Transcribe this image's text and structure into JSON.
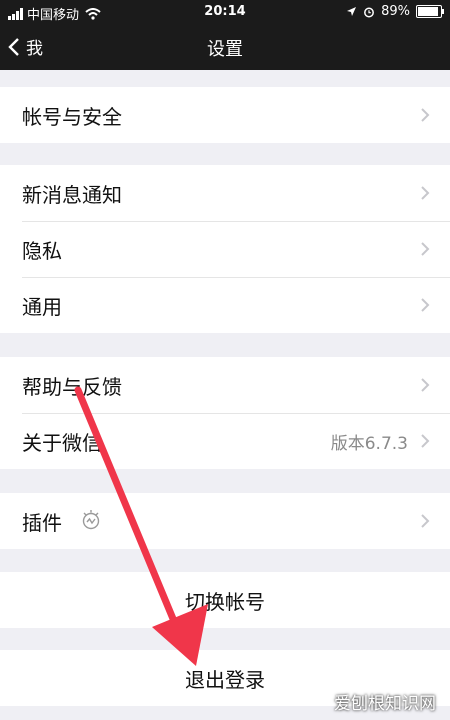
{
  "status": {
    "carrier": "中国移动",
    "time": "20:14",
    "battery": "89%",
    "battery_level": 0.89
  },
  "nav": {
    "back_label": "我",
    "title": "设置"
  },
  "groups": [
    {
      "items": [
        {
          "label": "帐号与安全"
        }
      ]
    },
    {
      "items": [
        {
          "label": "新消息通知"
        },
        {
          "label": "隐私"
        },
        {
          "label": "通用"
        }
      ]
    },
    {
      "items": [
        {
          "label": "帮助与反馈"
        },
        {
          "label": "关于微信",
          "value": "版本6.7.3"
        }
      ]
    },
    {
      "items": [
        {
          "label": "插件"
        }
      ]
    }
  ],
  "actions": {
    "switch_account": "切换帐号",
    "logout": "退出登录"
  },
  "watermark": "爱刨根知识网",
  "colors": {
    "annotation_arrow": "#f0364a",
    "nav_background": "#1b1b1b",
    "page_background": "#efeff4"
  }
}
